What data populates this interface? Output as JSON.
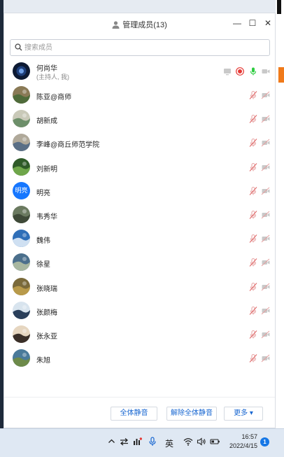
{
  "window": {
    "title": "管理成员(13)",
    "controls": {
      "minimize": "—",
      "maximize": "☐",
      "close": "✕"
    }
  },
  "search": {
    "placeholder": "搜索成员",
    "value": ""
  },
  "host": {
    "name": "何尚华",
    "role": "(主持人, 我)",
    "mic_on": true,
    "recording": true
  },
  "members": [
    {
      "name": "陈亚@商师",
      "avatar": "photo",
      "mic_muted": true,
      "video_off": true
    },
    {
      "name": "胡新成",
      "avatar": "photo",
      "mic_muted": true,
      "video_off": true
    },
    {
      "name": "李峰@商丘师范学院",
      "avatar": "photo",
      "mic_muted": true,
      "video_off": true
    },
    {
      "name": "刘新明",
      "avatar": "photo",
      "mic_muted": true,
      "video_off": true
    },
    {
      "name": "明亮",
      "avatar": "text",
      "avatar_text": "明亮",
      "mic_muted": true,
      "video_off": true
    },
    {
      "name": "韦秀华",
      "avatar": "photo",
      "mic_muted": true,
      "video_off": true
    },
    {
      "name": "魏伟",
      "avatar": "photo",
      "mic_muted": true,
      "video_off": true
    },
    {
      "name": "徐星",
      "avatar": "photo",
      "mic_muted": true,
      "video_off": true
    },
    {
      "name": "张晓瑞",
      "avatar": "photo",
      "mic_muted": true,
      "video_off": true
    },
    {
      "name": "张颜梅",
      "avatar": "photo",
      "mic_muted": true,
      "video_off": true
    },
    {
      "name": "张永亚",
      "avatar": "photo",
      "mic_muted": true,
      "video_off": true
    },
    {
      "name": "朱旭",
      "avatar": "photo",
      "mic_muted": true,
      "video_off": true
    }
  ],
  "footer": {
    "mute_all": "全体静音",
    "unmute_all": "解除全体静音",
    "more": "更多 ▾"
  },
  "taskbar": {
    "ime": "英",
    "time": "16:57",
    "date": "2022/4/15",
    "notifications": "1"
  },
  "colors": {
    "accent": "#1766d1",
    "mic_on": "#2ecc40",
    "record": "#e53935",
    "muted_icon": "#e8a7a7",
    "video_off_icon": "#c9c9c9"
  }
}
